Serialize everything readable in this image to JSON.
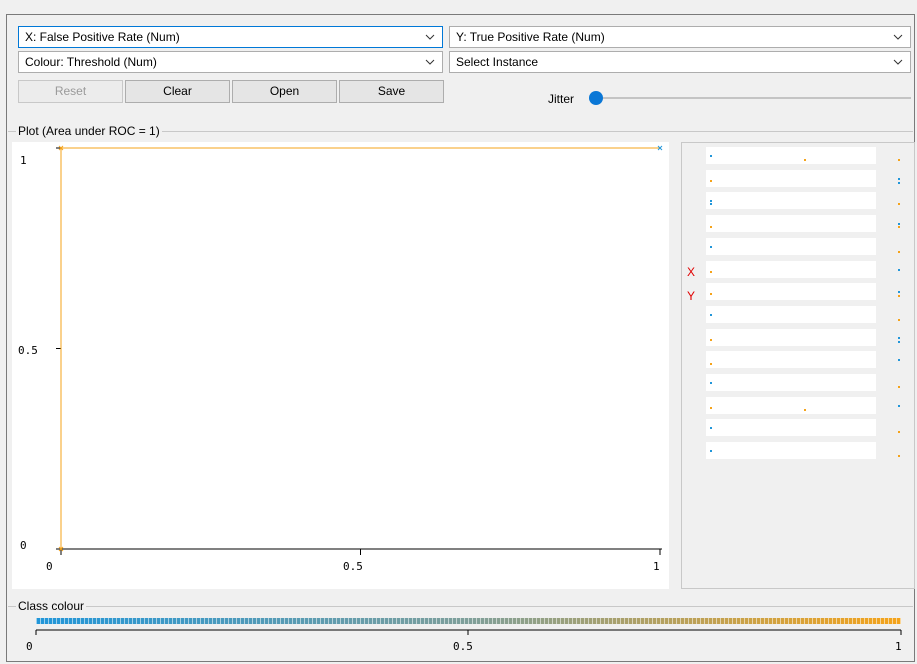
{
  "controls": {
    "x_axis": "X: False Positive Rate (Num)",
    "y_axis": "Y: True Positive Rate (Num)",
    "colour": "Colour: Threshold (Num)",
    "instance": "Select Instance"
  },
  "buttons": {
    "reset": "Reset",
    "clear": "Clear",
    "open": "Open",
    "save": "Save"
  },
  "jitter": {
    "label": "Jitter",
    "value": 0
  },
  "plot": {
    "title": "Plot (Area under ROC = 1)",
    "y_ticks": [
      "1",
      "0.5",
      "0"
    ],
    "x_ticks": [
      "0",
      "0.5",
      "1"
    ],
    "colors": {
      "curve": "#f5a31a",
      "low": "#2196d9",
      "high": "#f5a31a"
    }
  },
  "side_panel": {
    "x_label": "X",
    "y_label": "Y"
  },
  "class_colour": {
    "title": "Class colour",
    "ticks": [
      "0",
      "0.5",
      "1"
    ]
  },
  "chart_data": {
    "type": "line",
    "title": "Plot (Area under ROC = 1)",
    "xlabel": "False Positive Rate",
    "ylabel": "True Positive Rate",
    "xlim": [
      0,
      1
    ],
    "ylim": [
      0,
      1
    ],
    "series": [
      {
        "x": [
          0,
          0,
          1
        ],
        "y": [
          0,
          1,
          1
        ]
      }
    ]
  }
}
